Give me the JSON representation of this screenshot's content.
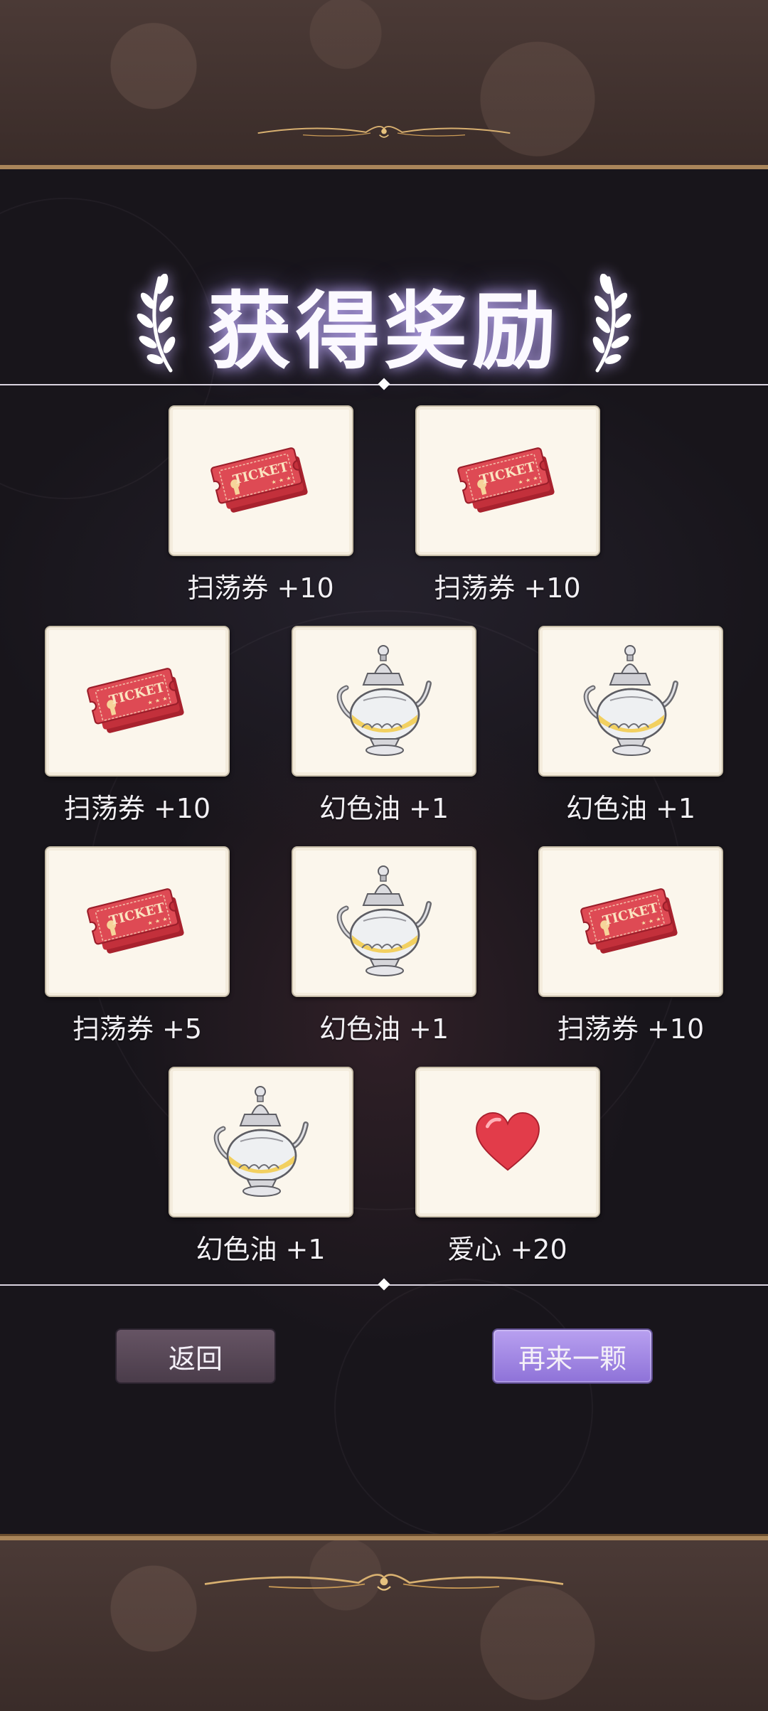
{
  "title": "获得奖励",
  "rewards": {
    "row1": [
      {
        "icon": "ticket-icon",
        "label": "扫荡券 +10"
      },
      {
        "icon": "ticket-icon",
        "label": "扫荡券 +10"
      }
    ],
    "row2": [
      {
        "icon": "ticket-icon",
        "label": "扫荡券 +10"
      },
      {
        "icon": "teapot-icon",
        "label": "幻色油 +1"
      },
      {
        "icon": "teapot-icon",
        "label": "幻色油 +1"
      }
    ],
    "row3": [
      {
        "icon": "ticket-icon",
        "label": "扫荡券 +5"
      },
      {
        "icon": "teapot-icon",
        "label": "幻色油 +1"
      },
      {
        "icon": "ticket-icon",
        "label": "扫荡券 +10"
      }
    ],
    "row4": [
      {
        "icon": "teapot-icon",
        "label": "幻色油 +1"
      },
      {
        "icon": "heart-icon",
        "label": "爱心 +20"
      }
    ]
  },
  "ticket_text": "TICKET",
  "buttons": {
    "back": "返回",
    "again": "再来一颗"
  },
  "colors": {
    "ticket": "#d6404a",
    "heart": "#e43a48",
    "accent": "#9c80e2",
    "gold": "#c9a46a"
  }
}
